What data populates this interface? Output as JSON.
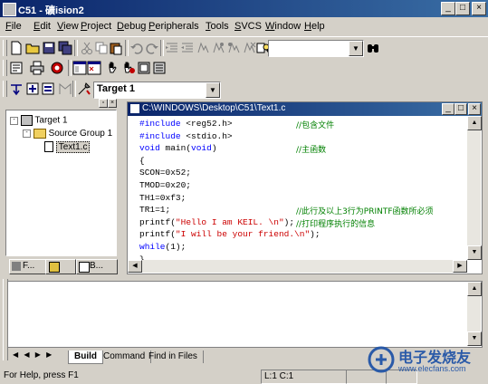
{
  "window": {
    "title": "C51 - 礦ision2"
  },
  "menu": [
    "File",
    "Edit",
    "View",
    "Project",
    "Debug",
    "Peripherals",
    "Tools",
    "SVCS",
    "Window",
    "Help"
  ],
  "menu_underline": [
    "F",
    "E",
    "V",
    "P",
    "D",
    "P",
    "T",
    "S",
    "W",
    "H"
  ],
  "toolbar": {
    "target_select": "Target 1"
  },
  "project": {
    "tree": [
      "Target 1",
      "Source Group 1",
      "Text1.c"
    ],
    "tabs": [
      "F...",
      "",
      "B..."
    ]
  },
  "editor": {
    "title": "C:\\WINDOWS\\Desktop\\C51\\Text1.c",
    "lines": [
      {
        "code": "#include <reg52.h>",
        "comment": "//包含文件"
      },
      {
        "code": "#include <stdio.h>",
        "comment": ""
      },
      {
        "code": "void main(void)",
        "comment": "//主函数"
      },
      {
        "code": "{",
        "comment": ""
      },
      {
        "code": "SCON=0x52;",
        "comment": ""
      },
      {
        "code": "TMOD=0x20;",
        "comment": ""
      },
      {
        "code": "TH1=0xf3;",
        "comment": ""
      },
      {
        "code": "TR1=1;",
        "comment": "//此行及以上3行为PRINTF函数所必须"
      },
      {
        "code": "printf(\"Hello I am KEIL. \\n\");",
        "comment": "//打印程序执行的信息"
      },
      {
        "code": "printf(\"I will be your friend.\\n\");",
        "comment": ""
      },
      {
        "code": "while(1);",
        "comment": ""
      },
      {
        "code": "}",
        "comment": ""
      }
    ]
  },
  "output": {
    "tabs": [
      "Build",
      "Command",
      "Find in Files"
    ]
  },
  "status": {
    "help": "For Help, press F1",
    "position": "L:1 C:1"
  },
  "watermark": {
    "brand": "电子发烧友",
    "url": "www.elecfans.com"
  }
}
